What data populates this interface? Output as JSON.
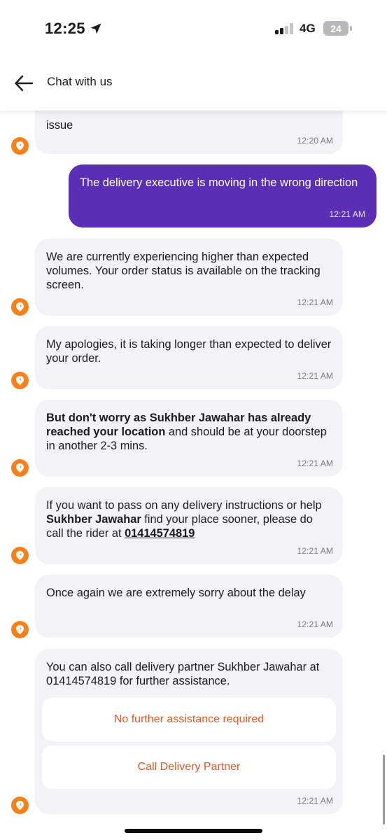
{
  "status_bar": {
    "time": "12:25",
    "network": "4G",
    "battery": "24"
  },
  "header": {
    "title": "Chat with us"
  },
  "colors": {
    "accent_orange": "#fc8019",
    "user_bubble": "#5a2fb5",
    "bot_bubble": "#f2f2f7",
    "option_text": "#e8571f"
  },
  "messages": [
    {
      "from": "bot",
      "text": "issue",
      "time": "12:20 AM"
    },
    {
      "from": "user",
      "text": "The delivery executive is moving in the wrong direction",
      "time": "12:21 AM"
    },
    {
      "from": "bot",
      "text": "We are currently experiencing higher than expected volumes. Your order status is available on the tracking screen.",
      "time": "12:21 AM"
    },
    {
      "from": "bot",
      "text": "My apologies, it is taking longer than expected to deliver your order.",
      "time": "12:21 AM"
    },
    {
      "from": "bot",
      "bold": "But don't worry as Sukhber Jawahar has already reached your location",
      "text": " and should be at your doorstep in another 2-3 mins.",
      "time": "12:21 AM"
    },
    {
      "from": "bot",
      "text_a": "If you want to pass on any delivery instructions or help ",
      "bold": "Sukhber Jawahar",
      "text_b": " find your place sooner, please do call the rider at ",
      "phone": "01414574819",
      "time": "12:21 AM"
    },
    {
      "from": "bot",
      "text": "Once again we are extremely sorry about the delay",
      "time": "12:21 AM"
    },
    {
      "from": "bot",
      "text": "You can also call delivery partner Sukhber Jawahar at 01414574819 for further assistance.",
      "time": "12:21 AM"
    }
  ],
  "options": [
    {
      "label": "No further assistance required"
    },
    {
      "label": "Call Delivery Partner"
    }
  ],
  "icons": {
    "avatar": "swiggy-logo-icon",
    "back": "arrow-left-icon",
    "location": "location-arrow-icon"
  }
}
